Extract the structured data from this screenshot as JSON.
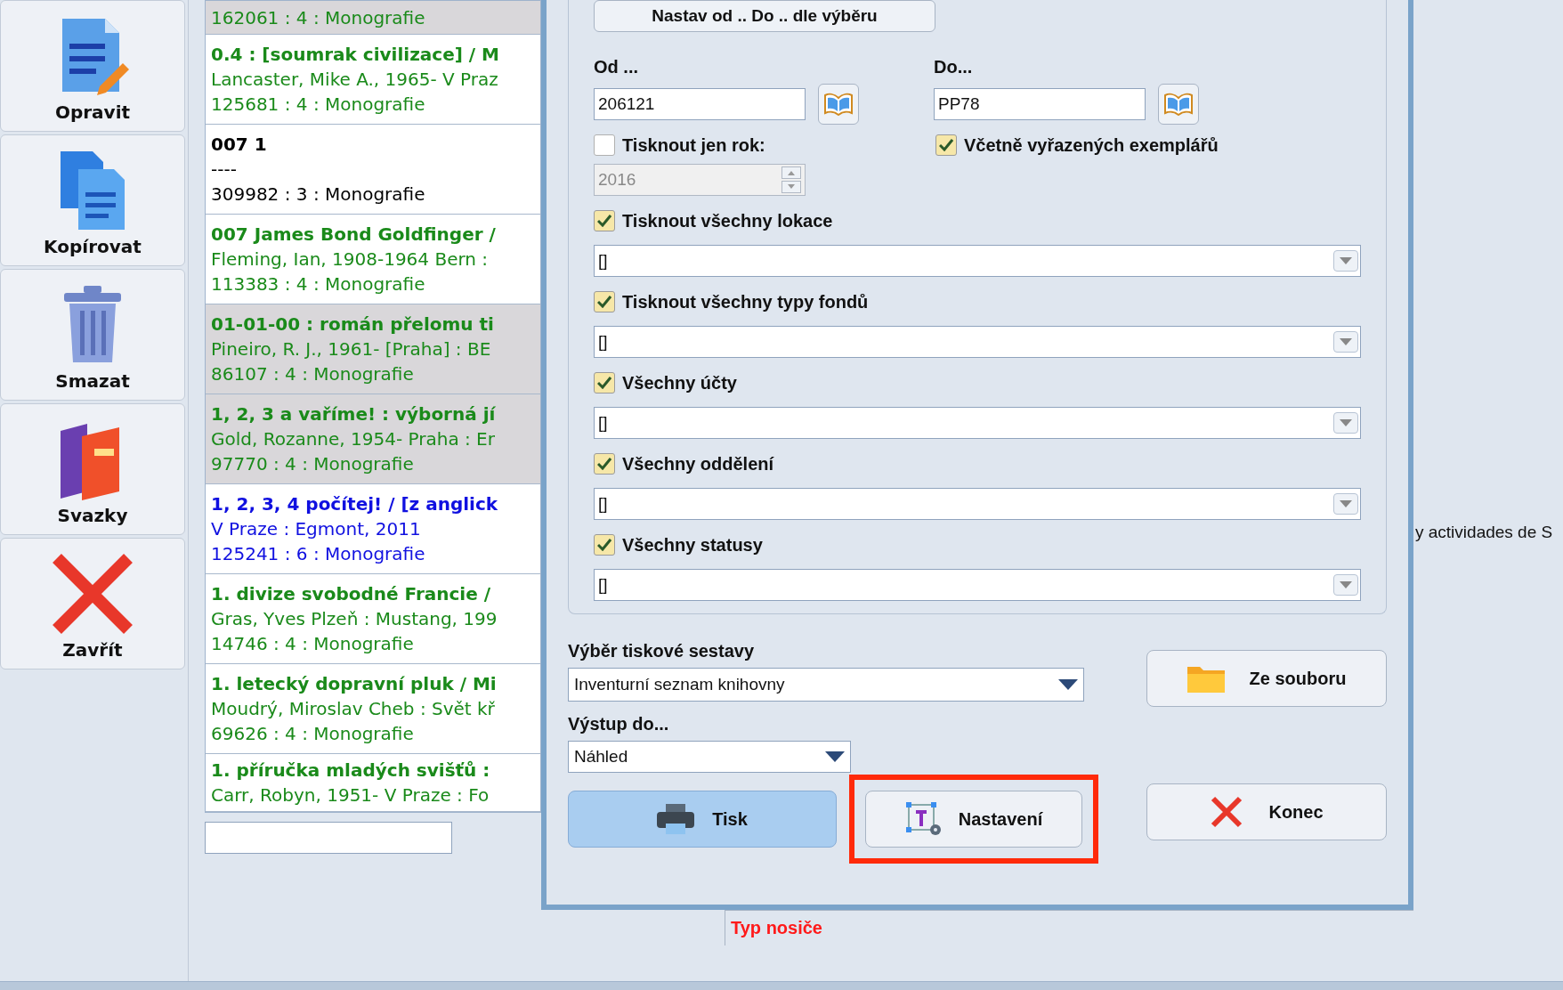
{
  "toolbar": [
    {
      "label": "Opravit",
      "kind": "edit"
    },
    {
      "label": "Kopírovat",
      "kind": "copy"
    },
    {
      "label": "Smazat",
      "kind": "delete"
    },
    {
      "label": "Svazky",
      "kind": "volumes"
    },
    {
      "label": "Zavřít",
      "kind": "close"
    }
  ],
  "records": [
    {
      "lines": [
        "162061 : 4 : Monografie"
      ],
      "color": "#1a8a1a",
      "shaded": true
    },
    {
      "lines": [
        "0.4 : [soumrak civilizace] / M",
        "Lancaster, Mike A., 1965- V Praz",
        "125681 : 4 : Monografie"
      ],
      "color": "#1a8a1a",
      "shaded": false
    },
    {
      "lines": [
        "007 1",
        "----",
        "309982 : 3 : Monografie"
      ],
      "color": "#000000",
      "shaded": false
    },
    {
      "lines": [
        "007 James Bond Goldfinger /",
        "Fleming, Ian, 1908-1964 Bern :",
        "113383 : 4 : Monografie"
      ],
      "color": "#1a8a1a",
      "shaded": false
    },
    {
      "lines": [
        "01-01-00 : román přelomu ti",
        "Pineiro, R. J., 1961- [Praha] : BE",
        "86107 : 4 : Monografie"
      ],
      "color": "#1a8a1a",
      "shaded": true
    },
    {
      "lines": [
        "1, 2, 3 a vaříme! : výborná jí",
        "Gold, Rozanne, 1954- Praha : Er",
        "97770 : 4 : Monografie"
      ],
      "color": "#1a8a1a",
      "shaded": true
    },
    {
      "lines": [
        "1, 2, 3, 4 počítej! / [z anglick",
        "V Praze : Egmont, 2011",
        "125241 : 6 : Monografie"
      ],
      "color": "#1010e0",
      "shaded": false
    },
    {
      "lines": [
        "1. divize svobodné Francie /",
        "Gras, Yves Plzeň : Mustang, 199",
        "14746 : 4 : Monografie"
      ],
      "color": "#1a8a1a",
      "shaded": false
    },
    {
      "lines": [
        "1. letecký dopravní pluk / Mi",
        "Moudrý, Miroslav Cheb : Svět kř",
        "69626 : 4 : Monografie"
      ],
      "color": "#1a8a1a",
      "shaded": false
    },
    {
      "lines": [
        "1. příručka mladých svišťů :",
        "Carr, Robyn, 1951- V Praze : Fo"
      ],
      "color": "#1a8a1a",
      "shaded": false
    }
  ],
  "dialog": {
    "range_button": "Nastav  od .. Do .. dle výběru",
    "from": {
      "label": "Od ...",
      "value": "206121"
    },
    "to": {
      "label": "Do...",
      "value": "PP78"
    },
    "year": {
      "label": "Tisknout jen  rok:",
      "checked": false,
      "value": "2016",
      "disabled": true
    },
    "include_discarded": {
      "label": "Včetně vyřazených exemplářů",
      "checked": true
    },
    "filters": [
      {
        "label": "Tisknout všechny lokace",
        "checked": true,
        "value": "[]"
      },
      {
        "label": "Tisknout všechny typy fondů",
        "checked": true,
        "value": "[]"
      },
      {
        "label": "Všechny účty",
        "checked": true,
        "value": "[]"
      },
      {
        "label": "Všechny oddělení",
        "checked": true,
        "value": "[]"
      },
      {
        "label": "Všechny statusy",
        "checked": true,
        "value": "[]"
      }
    ],
    "report": {
      "label": "Výběr tiskové sestavy",
      "value": "Inventurní seznam knihovny"
    },
    "output": {
      "label": "Výstup do...",
      "value": "Náhled"
    },
    "buttons": [
      {
        "label": "Ze souboru",
        "kind": "folder"
      },
      {
        "label": "Tisk",
        "kind": "print"
      },
      {
        "label": "Nastavení",
        "kind": "settings",
        "highlighted": true
      },
      {
        "label": "Konec",
        "kind": "close"
      }
    ]
  },
  "background": {
    "side_text": "y actividades de S",
    "field_label": "Typ nosiče"
  }
}
